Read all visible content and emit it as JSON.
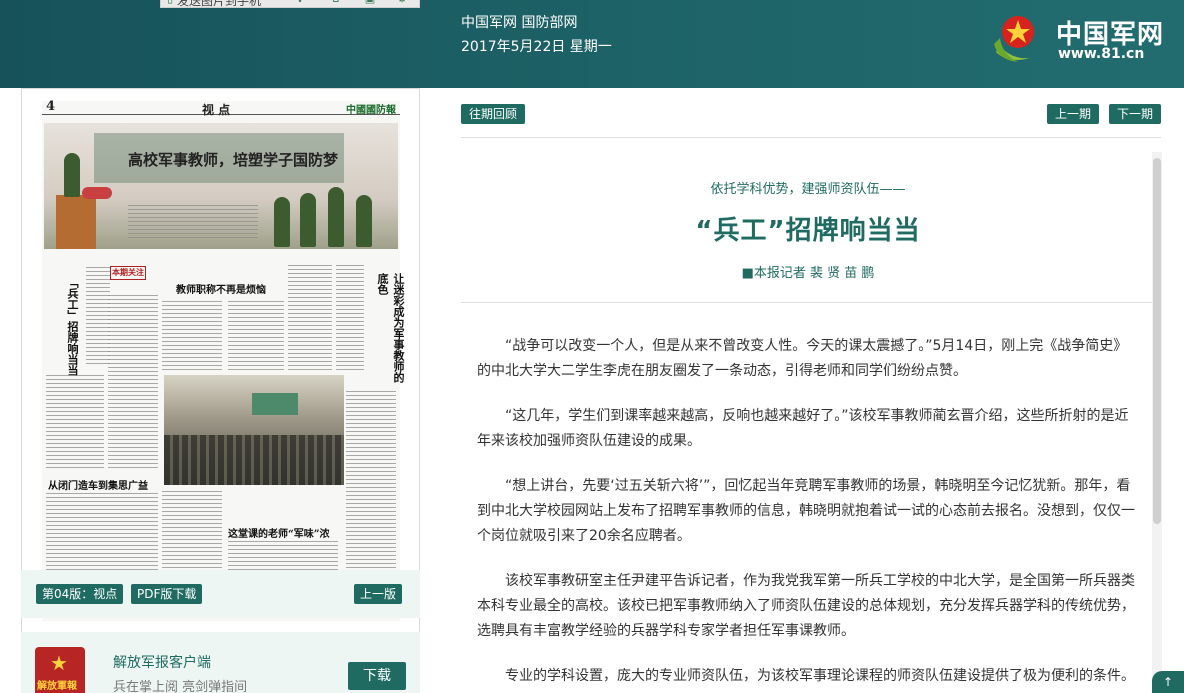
{
  "header": {
    "site": "中国军网 国防部网",
    "date": "2017年5月22日 星期一",
    "logo_text": "中国军网",
    "logo_url": "www.81.cn"
  },
  "toolbar": {
    "send_label": "发送图片到手机"
  },
  "newspaper": {
    "page_no": "4",
    "section": "视 点",
    "paper_name": "中國國防報",
    "banner_title": "高校军事教师，培塑学子国防梦",
    "headline_1": "「兵工」招牌响当当",
    "headline_2": "教师职称不再是烦恼",
    "headline_3": "让迷彩成为军事教师的底色",
    "headline_4": "从闭门造车到集思广益",
    "headline_5": "这堂课的老师“军味”浓",
    "focus_badge": "本期关注"
  },
  "edition": {
    "current": "第04版：视点",
    "pdf": "PDF版下载",
    "prev": "上一版"
  },
  "app": {
    "title": "解放军报客户端",
    "subtitle": "兵在掌上阅 亮剑弹指间",
    "download": "下载",
    "icon_text": "解放軍報"
  },
  "nav": {
    "archive": "往期回顾",
    "prev_issue": "上一期",
    "next_issue": "下一期"
  },
  "article": {
    "kicker": "依托学科优势，建强师资队伍——",
    "title": "“兵工”招牌响当当",
    "byline": "■本报记者 裴 贤 苗 鹏",
    "paragraphs": [
      "“战争可以改变一个人，但是从来不曾改变人性。今天的课太震撼了。”5月14日，刚上完《战争简史》的中北大学大二学生李虎在朋友圈发了一条动态，引得老师和同学们纷纷点赞。",
      "“这几年，学生们到课率越来越高，反响也越来越好了。”该校军事教师蔺玄晋介绍，这些所折射的是近年来该校加强师资队伍建设的成果。",
      "“想上讲台，先要‘过五关斩六将’”，回忆起当年竞聘军事教师的场景，韩晓明至今记忆犹新。那年，看到中北大学校园网站上发布了招聘军事教师的信息，韩晓明就抱着试一试的心态前去报名。没想到，仅仅一个岗位就吸引来了20余名应聘者。",
      "该校军事教研室主任尹建平告诉记者，作为我党我军第一所兵工学校的中北大学，是全国第一所兵器类本科专业最全的高校。该校已把军事教师纳入了师资队伍建设的总体规划，充分发挥兵器学科的传统优势，选聘具有丰富教学经验的兵器学科专家学者担任军事课教师。",
      "专业的学科设置，庞大的专业师资队伍，为该校军事理论课程的师资队伍建设提供了极为便利的条件。"
    ]
  },
  "colors": {
    "header_bg": "#1d6367",
    "accent": "#1f6b62",
    "panel_bg": "#eef6f3"
  },
  "icons": [
    "phone-icon",
    "share-icon",
    "home-icon",
    "save-icon",
    "settings-icon",
    "back-to-top-icon"
  ]
}
